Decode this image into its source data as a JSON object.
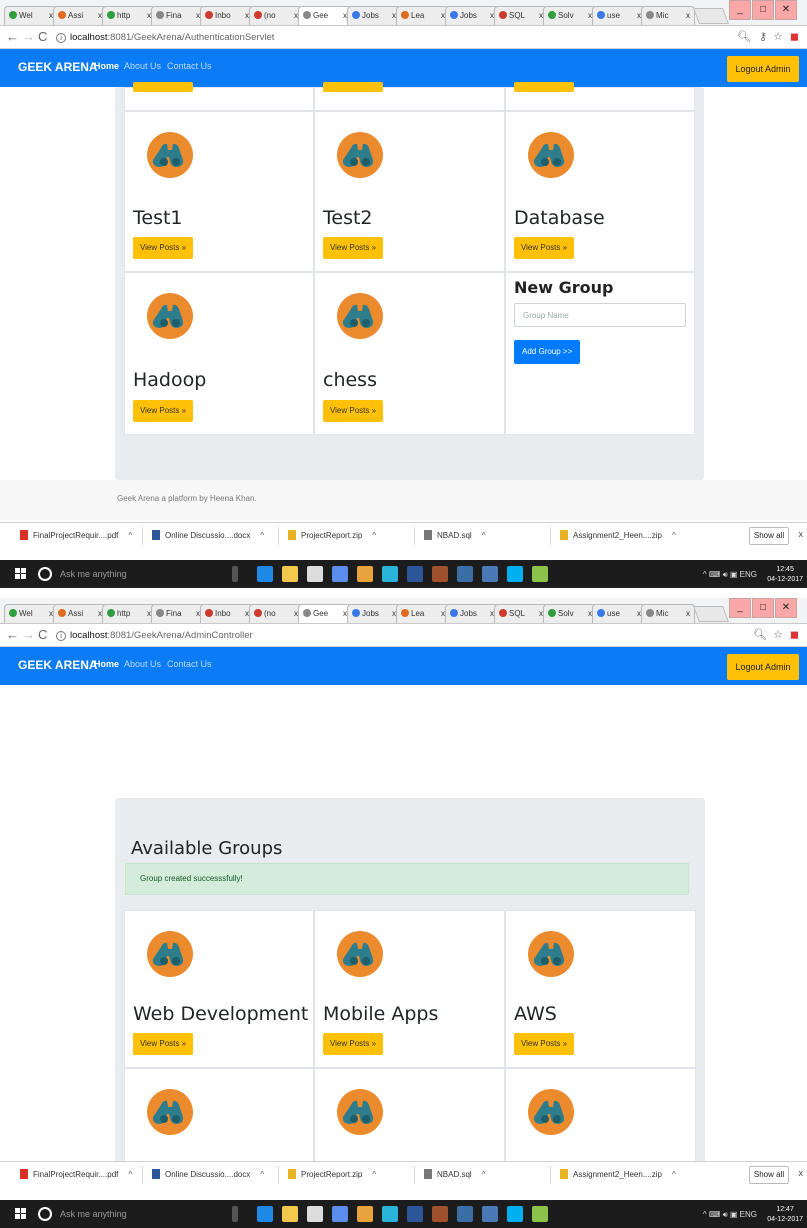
{
  "tabs": [
    "Wel",
    "Assi",
    "http",
    "Fina",
    "Inbo",
    "(no",
    "Gee",
    "Jobs",
    "Lea",
    "Jobs",
    "SQL",
    "Solv",
    "use",
    "Mic"
  ],
  "tab_close": "x",
  "shot1": {
    "url_host": "localhost",
    "url_rest": ":8081/GeekArena/AuthenticationServlet",
    "brand": "GEEK ARENA",
    "nav": [
      "Home",
      "About Us",
      "Contact Us"
    ],
    "logout": "Logout Admin",
    "groups": [
      {
        "name": "Test1",
        "button": "View Posts »"
      },
      {
        "name": "Test2",
        "button": "View Posts »"
      },
      {
        "name": "Database",
        "button": "View Posts »"
      },
      {
        "name": "Hadoop",
        "button": "View Posts »"
      },
      {
        "name": "chess",
        "button": "View Posts »"
      }
    ],
    "new_group": {
      "title": "New Group",
      "placeholder": "Group Name",
      "button": "Add Group >>"
    },
    "footer": "Geek Arena a platform by Heena Khan.",
    "clock_time": "12:45",
    "clock_date": "04-12-2017"
  },
  "shot2": {
    "url_host": "localhost",
    "url_rest": ":8081/GeekArena/AdminController",
    "brand": "GEEK ARENA",
    "nav": [
      "Home",
      "About Us",
      "Contact Us"
    ],
    "logout": "Logout Admin",
    "page_title": "Available Groups",
    "alert": "Group created successsfully!",
    "groups": [
      {
        "name": "Web Development",
        "button": "View Posts »"
      },
      {
        "name": "Mobile Apps",
        "button": "View Posts »"
      },
      {
        "name": "AWS",
        "button": "View Posts »"
      }
    ],
    "clock_time": "12:47",
    "clock_date": "04-12-2017"
  },
  "downloads": [
    {
      "name": "FinalProjectRequir....pdf",
      "color": "#d93025"
    },
    {
      "name": "Online Discussio....docx",
      "color": "#2b579a"
    },
    {
      "name": "ProjectReport.zip",
      "color": "#e6b422"
    },
    {
      "name": "NBAD.sql",
      "color": "#777777"
    },
    {
      "name": "Assignment2_Heen....zip",
      "color": "#e6b422"
    }
  ],
  "show_all": "Show all",
  "dl_close": "x",
  "taskbar": {
    "search": "Ask me anything",
    "lang": "ENG"
  },
  "colors": {
    "navbar": "#0b7cf5",
    "warning": "#ffc107",
    "primary": "#007bff",
    "logo": "#ec8a2e"
  }
}
